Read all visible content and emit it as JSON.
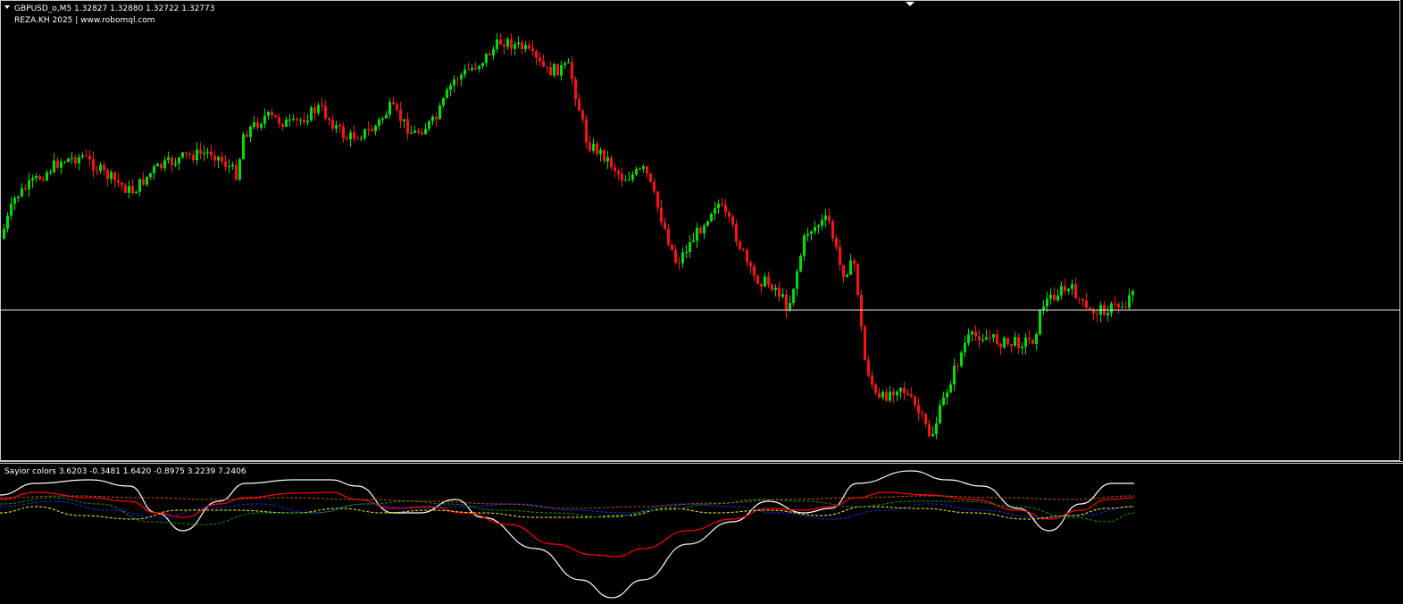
{
  "main": {
    "symbol_line": "GBPUSD_o,M5  1.32827 1.32880 1.32722 1.32773",
    "brand_line": "REZA.KH 2025 | www.robomql.com",
    "hline_color": "#e0e0e0",
    "bull_color": "#00e000",
    "bear_color": "#ff1010",
    "collapse_arrow_icon": "triangle-down-icon"
  },
  "indicator": {
    "label": "Sayior colors 3.6203 -0.3481 1.6420 -0.8975 3.2239 7.2406",
    "colors": {
      "white": "#ffffff",
      "red": "#ff0000",
      "blue": "#1030ff",
      "yellow": "#ffff00",
      "green": "#00a000",
      "orange": "#c05020"
    }
  },
  "colors": {
    "background": "#000000",
    "border": "#c8c8c8"
  }
}
